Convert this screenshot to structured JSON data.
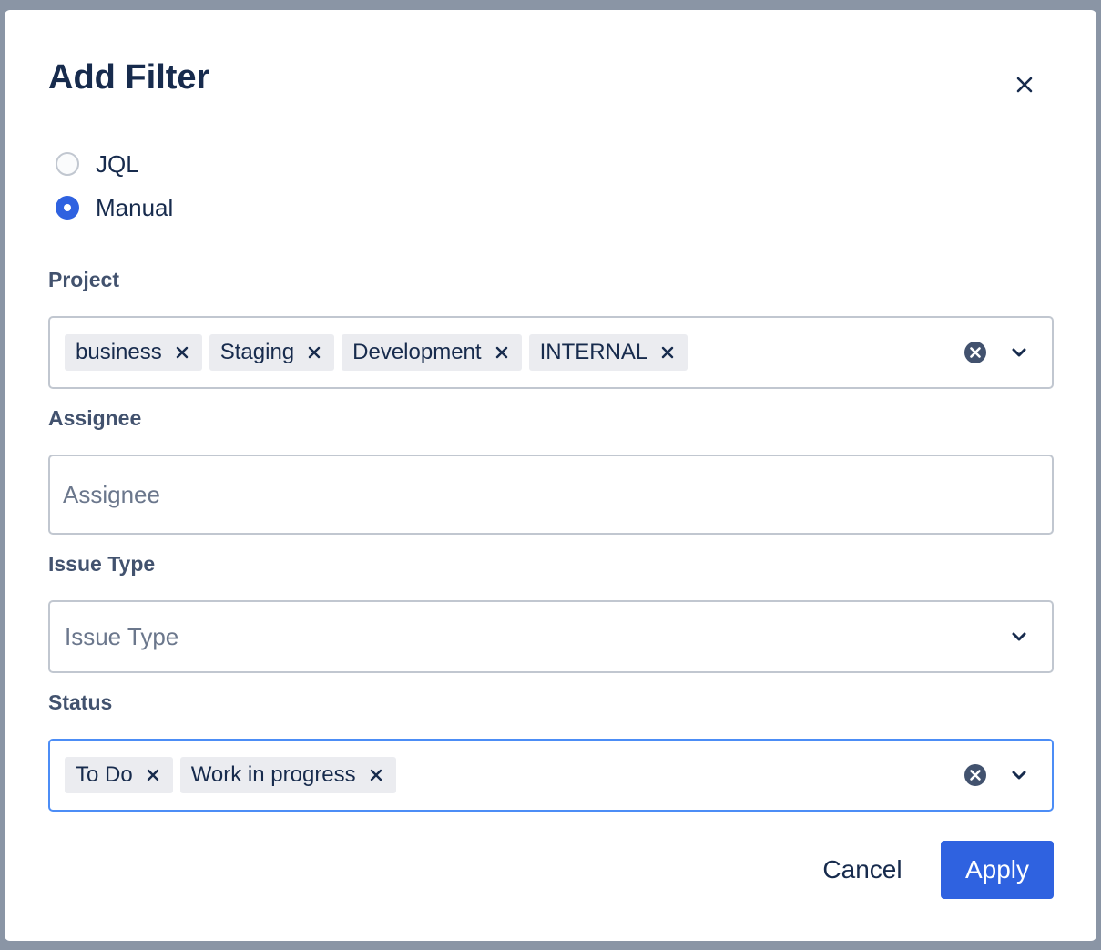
{
  "dialog": {
    "title": "Add Filter",
    "close_icon": "close-icon"
  },
  "query_mode": {
    "options": [
      {
        "label": "JQL",
        "checked": false
      },
      {
        "label": "Manual",
        "checked": true
      }
    ]
  },
  "fields": {
    "project": {
      "label": "Project",
      "tags": [
        "business",
        "Staging",
        "Development",
        "INTERNAL"
      ]
    },
    "assignee": {
      "label": "Assignee",
      "placeholder": "Assignee"
    },
    "issue_type": {
      "label": "Issue Type",
      "placeholder": "Issue Type"
    },
    "status": {
      "label": "Status",
      "tags": [
        "To Do",
        "Work in progress"
      ]
    }
  },
  "footer": {
    "cancel_label": "Cancel",
    "apply_label": "Apply"
  },
  "colors": {
    "primary": "#2f62e0",
    "focus_border": "#4c8df6",
    "text": "#172b4d",
    "tag_bg": "#ebecf0"
  }
}
